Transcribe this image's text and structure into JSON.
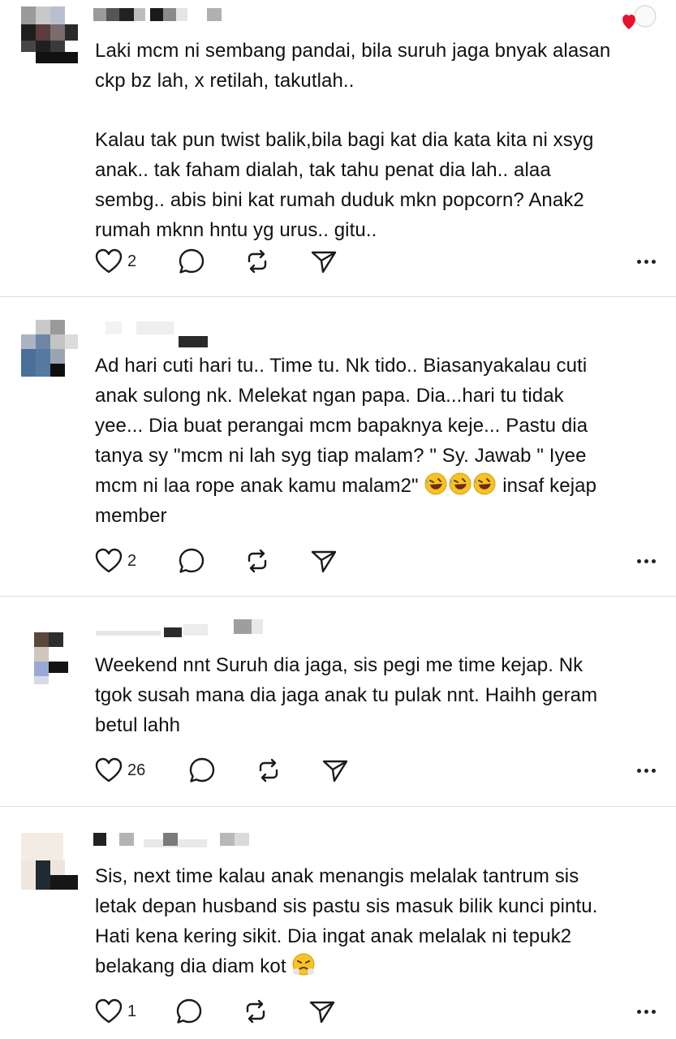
{
  "posts": [
    {
      "paragraphs": [
        "Laki mcm ni sembang pandai, bila suruh jaga bnyak alasan\nckp bz lah, x retilah, takutlah..",
        "Kalau tak pun twist balik,bila bagi kat dia kata kita ni xsyg\nanak.. tak faham dialah, tak tahu penat dia lah.. alaa\nsembg.. abis bini kat rumah duduk mkn popcorn? Anak2\nrumah mknn hntu yg urus.. gitu.."
      ],
      "likes": "2"
    },
    {
      "lines": [
        "Ad hari cuti hari tu.. Time tu. Nk tido.. Biasanyakalau cuti",
        "anak sulong nk. Melekat ngan papa. Dia...hari tu tidak",
        "yee... Dia buat perangai mcm bapaknya keje... Pastu dia",
        "tanya sy \"mcm ni lah syg tiap malam? \" Sy. Jawab \" Iyee",
        "mcm ni laa rope anak kamu malam2\"",
        "insaf kejap",
        "member"
      ],
      "emoji": "rolling-on-floor-laughing",
      "likes": "2"
    },
    {
      "paragraphs": [
        "Weekend nnt Suruh dia jaga, sis pegi me time kejap. Nk\ntgok susah mana dia jaga anak tu pulak nnt. Haihh geram\nbetul lahh"
      ],
      "likes": "26"
    },
    {
      "lines": [
        "Sis, next time kalau anak menangis melalak tantrum sis",
        "letak depan husband sis pastu sis masuk bilik kunci pintu.",
        "Hati kena kering sikit. Dia ingat anak melalak ni tepuk2",
        "belakang dia diam kot"
      ],
      "emoji": "face-with-steam-from-nose",
      "likes": "1"
    }
  ],
  "icons": {
    "like": "heart-outline-icon",
    "reply": "speech-bubble-icon",
    "repost": "repost-arrows-icon",
    "share": "send-paper-plane-icon",
    "more": "more-dots-icon",
    "liked": "red-heart-icon"
  },
  "colors": {
    "liked_heart": "#e8112d",
    "divider": "#dcdcdc",
    "text": "#111111"
  }
}
